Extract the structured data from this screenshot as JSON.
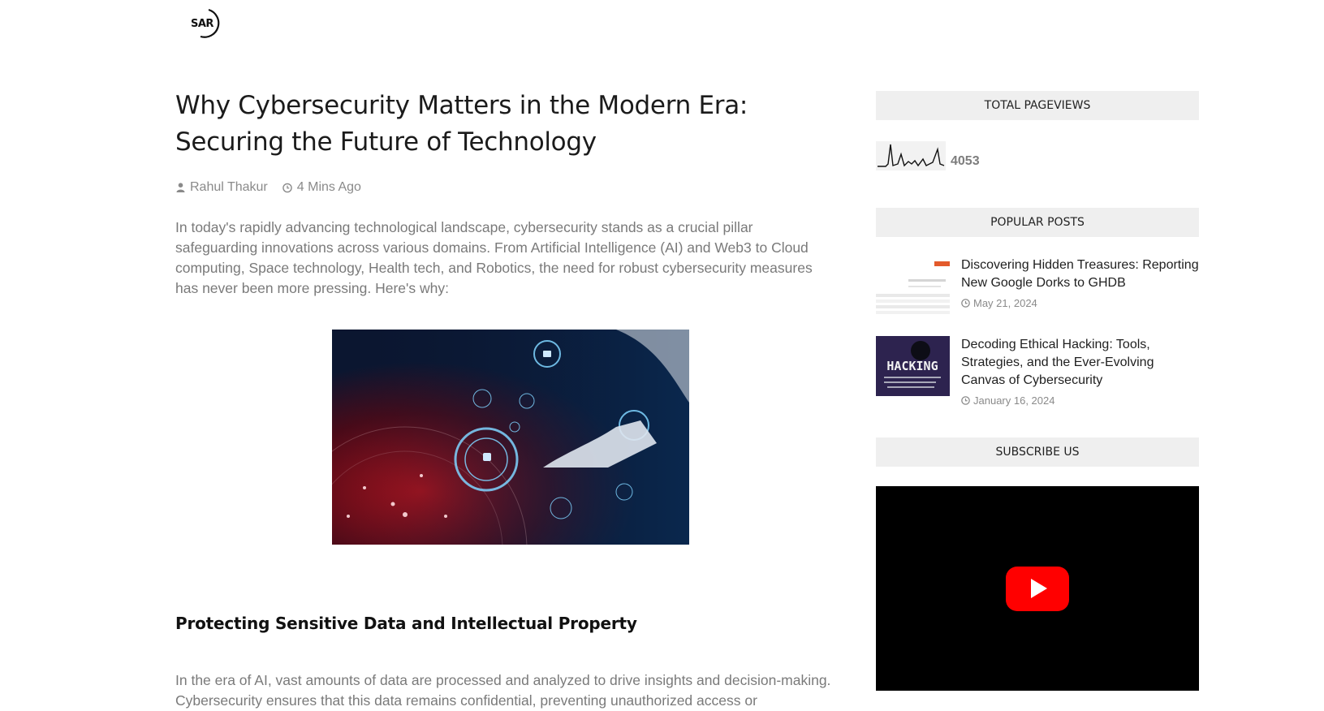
{
  "logo": {
    "text": "SAR"
  },
  "post": {
    "title": "Why Cybersecurity Matters in the Modern Era: Securing the Future of Technology",
    "author": "Rahul Thakur",
    "time": "4 Mins Ago",
    "intro": "In today's rapidly advancing technological landscape, cybersecurity stands as a crucial pillar safeguarding innovations across various domains. From Artificial Intelligence (AI) and Web3 to Cloud computing, Space technology, Health tech, and Robotics, the need for robust cybersecurity measures has never been more pressing. Here's why:",
    "section_heading": "Protecting Sensitive Data and Intellectual Property",
    "section_text": "In the era of AI, vast amounts of data are processed and analyzed to drive insights and decision-making. Cybersecurity ensures that this data remains confidential, preventing unauthorized access or"
  },
  "sidebar": {
    "pageviews_heading": "TOTAL PAGEVIEWS",
    "pageviews_count": "4053",
    "popular_heading": "POPULAR POSTS",
    "popular_posts": [
      {
        "title": "Discovering Hidden Treasures: Reporting New Google Dorks to GHDB",
        "date": "May 21, 2024"
      },
      {
        "title": "Decoding Ethical Hacking: Tools, Strategies, and the Ever-Evolving Canvas of Cybersecurity",
        "date": "January 16, 2024",
        "thumb_text": "HACKING"
      }
    ],
    "subscribe_heading": "SUBSCRIBE US"
  },
  "icons": {
    "author": "user-icon",
    "time": "clock-icon",
    "date": "clock-icon",
    "video": "youtube-play-icon"
  }
}
